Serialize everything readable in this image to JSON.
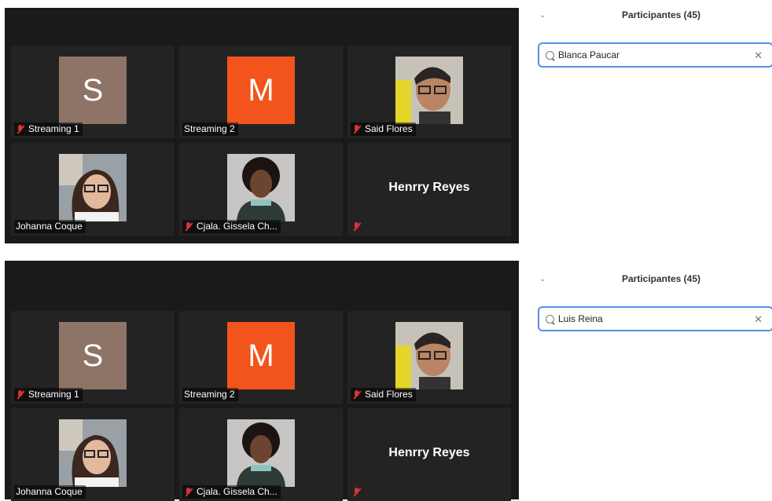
{
  "views": [
    {
      "tiles": [
        {
          "type": "letter",
          "letter": "S",
          "bg": "#8e7367",
          "name": "Streaming 1",
          "muted": true
        },
        {
          "type": "letter",
          "letter": "M",
          "bg": "#f2541b",
          "name": "Streaming 2",
          "muted": false
        },
        {
          "type": "photo",
          "name": "Said Flores",
          "muted": true
        },
        {
          "type": "photo",
          "name": "Johanna Coque",
          "muted": false
        },
        {
          "type": "photo",
          "name": "Cjala. Gissela Ch...",
          "muted": true
        },
        {
          "type": "nameonly",
          "display": "Henrry Reyes",
          "muted": true
        }
      ],
      "participants_title": "Participantes (45)",
      "search_value": "Blanca Paucar"
    },
    {
      "tiles": [
        {
          "type": "letter",
          "letter": "S",
          "bg": "#8e7367",
          "name": "Streaming 1",
          "muted": true
        },
        {
          "type": "letter",
          "letter": "M",
          "bg": "#f2541b",
          "name": "Streaming 2",
          "muted": false
        },
        {
          "type": "photo",
          "name": "Said Flores",
          "muted": true
        },
        {
          "type": "photo",
          "name": "Johanna Coque",
          "muted": false
        },
        {
          "type": "photo",
          "name": "Cjala. Gissela Ch...",
          "muted": true
        },
        {
          "type": "nameonly",
          "display": "Henrry Reyes",
          "muted": true
        }
      ],
      "participants_title": "Participantes (45)",
      "search_value": "Luis Reina"
    }
  ],
  "icons": {
    "chevron": "chevron-down-icon",
    "search": "search-icon",
    "clear": "close-icon",
    "mic": "mic-muted-icon"
  }
}
